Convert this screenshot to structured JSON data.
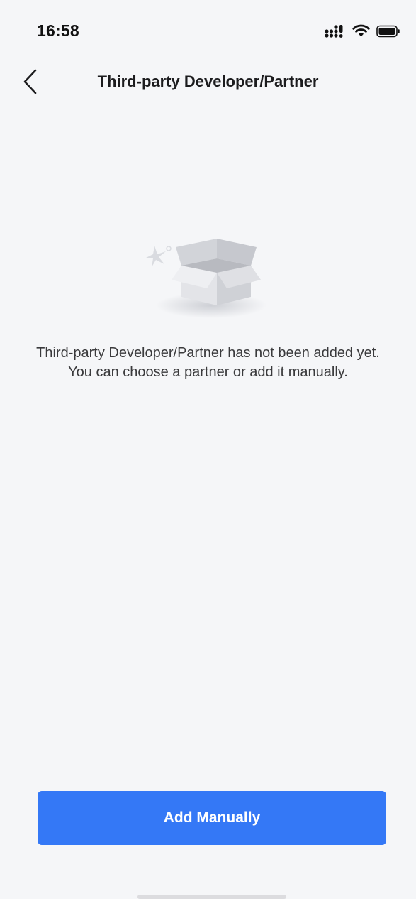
{
  "status_bar": {
    "time": "16:58",
    "icons": [
      "signal-icon",
      "wifi-icon",
      "battery-icon"
    ]
  },
  "nav": {
    "back_icon": "chevron-left-icon",
    "title": "Third-party Developer/Partner"
  },
  "empty_state": {
    "illustration": "open-box-icon",
    "message": "Third-party Developer/Partner has not been added yet. You can choose a partner or add it manually."
  },
  "actions": {
    "add_manually_label": "Add Manually"
  },
  "colors": {
    "background": "#f5f6f8",
    "primary": "#3478f6",
    "title_text": "#1c1c1e",
    "body_text": "#3a3a3c"
  }
}
